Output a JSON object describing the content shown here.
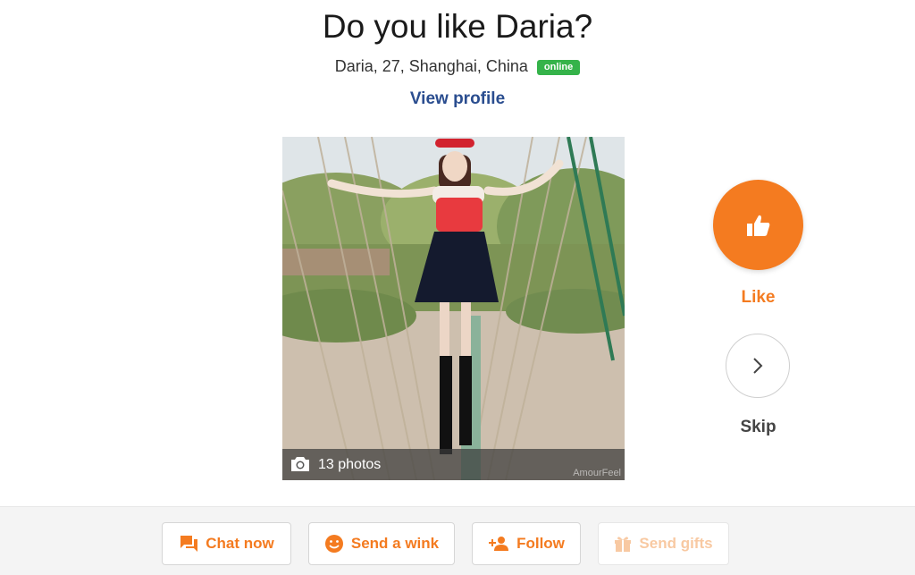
{
  "header": {
    "title": "Do you like Daria?",
    "details": "Daria, 27, Shanghai, China",
    "status_badge": "online",
    "view_profile": "View profile"
  },
  "photo": {
    "count_label": "13 photos",
    "watermark": "AmourFeel"
  },
  "actions": {
    "like": "Like",
    "skip": "Skip"
  },
  "footer": {
    "chat": "Chat now",
    "wink": "Send a wink",
    "follow": "Follow",
    "gifts": "Send gifts"
  },
  "colors": {
    "accent": "#f47b20",
    "link": "#2a4d8f",
    "online": "#35b34a"
  },
  "icons": [
    "thumbs-up-icon",
    "chevron-right-icon",
    "camera-icon",
    "chat-icon",
    "smile-icon",
    "add-person-icon",
    "gift-icon"
  ]
}
